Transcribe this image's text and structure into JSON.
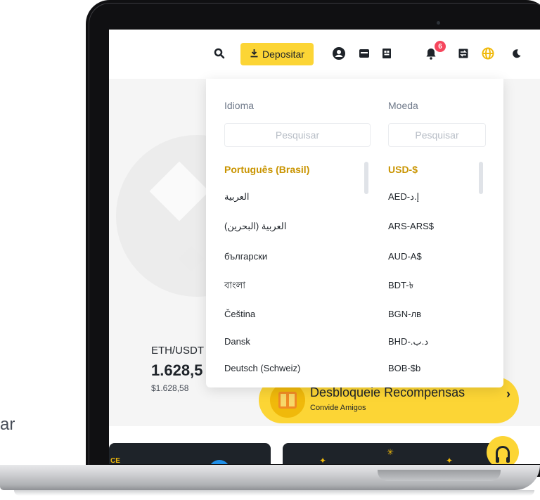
{
  "side_text": "ar",
  "header": {
    "deposit_label": "Depositar",
    "notification_count": "6",
    "icons": [
      "search-icon",
      "download-icon",
      "user-icon",
      "wallet-icon",
      "orders-icon",
      "bell-icon",
      "transfer-icon",
      "globe-icon",
      "moon-icon"
    ]
  },
  "dropdown": {
    "language": {
      "heading": "Idioma",
      "placeholder": "Pesquisar",
      "items": [
        "Português (Brasil)",
        "العربية",
        "العربية (البحرين)",
        "български",
        "বাংলা",
        "Čeština",
        "Dansk",
        "Deutsch (Schweiz)"
      ],
      "selected_index": 0
    },
    "currency": {
      "heading": "Moeda",
      "placeholder": "Pesquisar",
      "items": [
        "USD-$",
        "AED-إ.د",
        "ARS-ARS$",
        "AUD-A$",
        "BDT-৳",
        "BGN-лв",
        "BHD-.د.ب",
        "BOB-$b"
      ],
      "selected_index": 0
    }
  },
  "ticker": {
    "pair": "ETH/USDT",
    "price": "1.628,5",
    "fiat": "$1.628,58"
  },
  "reward": {
    "title": "Desbloqueie Recompensas",
    "subtitle": "Convide Amigos",
    "arrow": "›"
  },
  "cards": {
    "left_label": "CE"
  },
  "colors": {
    "accent": "#fcd535",
    "selected_text": "#c99400",
    "badge": "#f6465d"
  }
}
